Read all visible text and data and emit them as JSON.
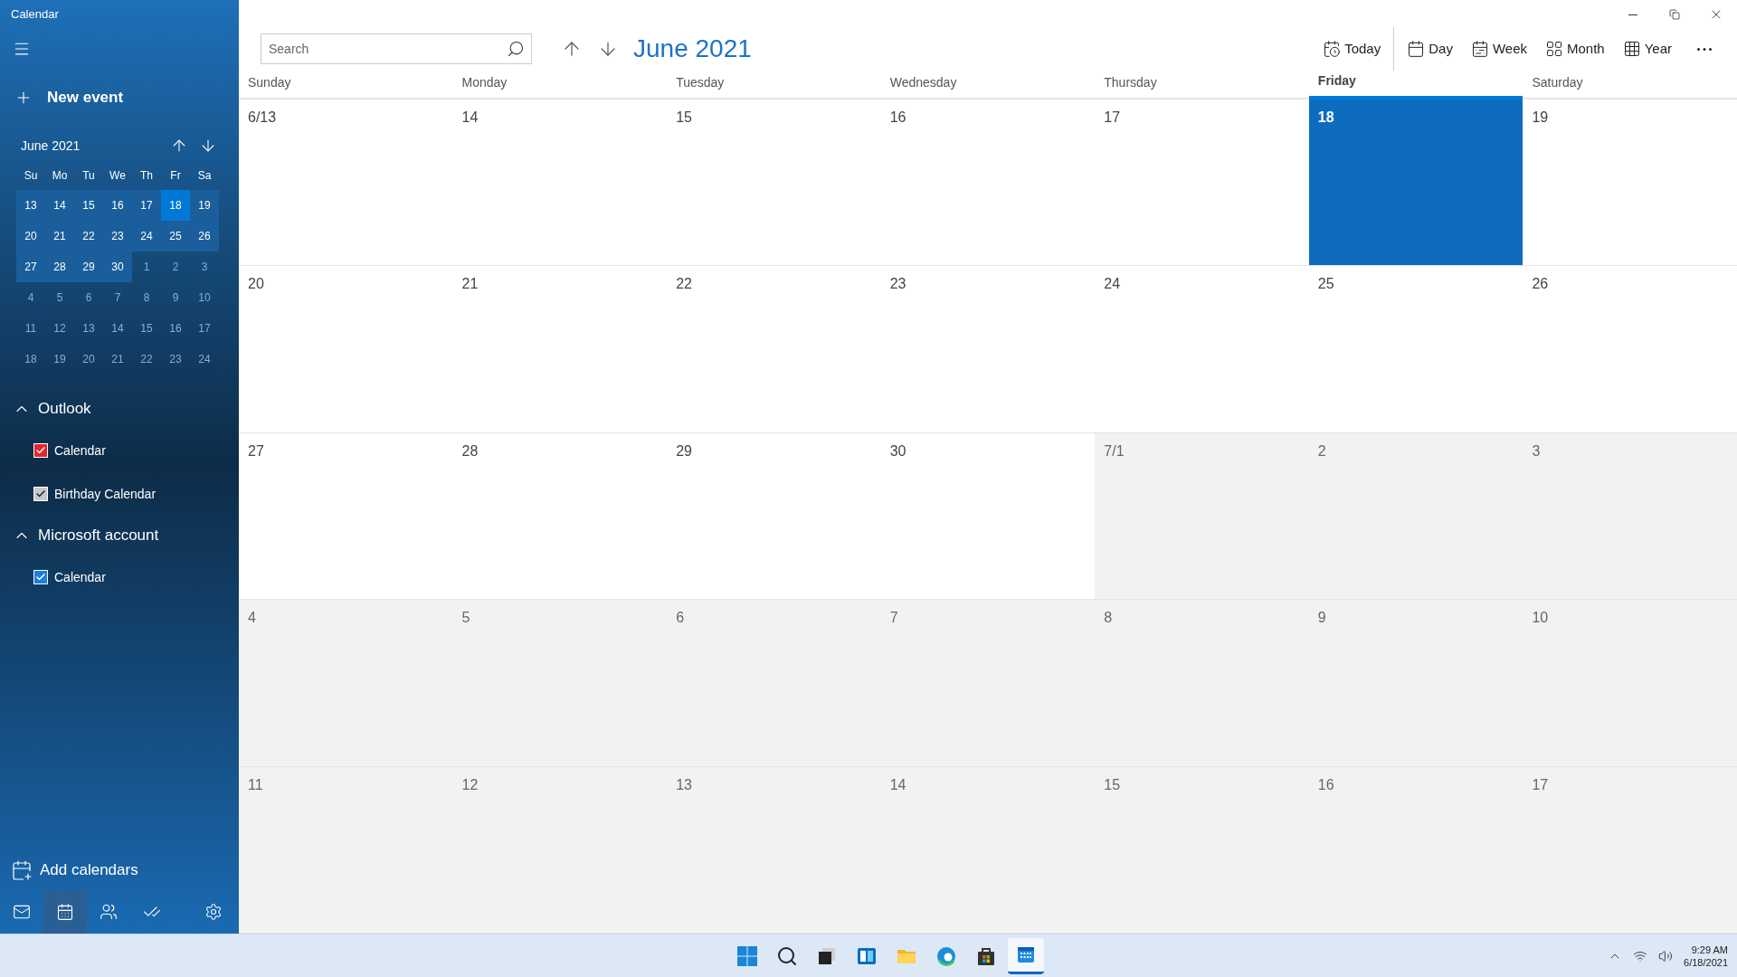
{
  "window": {
    "title": "Calendar"
  },
  "sidebar": {
    "new_event": "New event",
    "mini_calendar": {
      "title": "June 2021",
      "weekdays": [
        "Su",
        "Mo",
        "Tu",
        "We",
        "Th",
        "Fr",
        "Sa"
      ],
      "weeks": [
        [
          {
            "text": "13",
            "in_range": true,
            "selected": false
          },
          {
            "text": "14",
            "in_range": true,
            "selected": false
          },
          {
            "text": "15",
            "in_range": true,
            "selected": false
          },
          {
            "text": "16",
            "in_range": true,
            "selected": false
          },
          {
            "text": "17",
            "in_range": true,
            "selected": false
          },
          {
            "text": "18",
            "in_range": true,
            "selected": true
          },
          {
            "text": "19",
            "in_range": true,
            "selected": false
          }
        ],
        [
          {
            "text": "20",
            "in_range": true,
            "selected": false
          },
          {
            "text": "21",
            "in_range": true,
            "selected": false
          },
          {
            "text": "22",
            "in_range": true,
            "selected": false
          },
          {
            "text": "23",
            "in_range": true,
            "selected": false
          },
          {
            "text": "24",
            "in_range": true,
            "selected": false
          },
          {
            "text": "25",
            "in_range": true,
            "selected": false
          },
          {
            "text": "26",
            "in_range": true,
            "selected": false
          }
        ],
        [
          {
            "text": "27",
            "in_range": true,
            "selected": false
          },
          {
            "text": "28",
            "in_range": true,
            "selected": false
          },
          {
            "text": "29",
            "in_range": true,
            "selected": false
          },
          {
            "text": "30",
            "in_range": true,
            "selected": false
          },
          {
            "text": "1",
            "in_range": false,
            "selected": false
          },
          {
            "text": "2",
            "in_range": false,
            "selected": false
          },
          {
            "text": "3",
            "in_range": false,
            "selected": false
          }
        ],
        [
          {
            "text": "4",
            "in_range": false,
            "selected": false
          },
          {
            "text": "5",
            "in_range": false,
            "selected": false
          },
          {
            "text": "6",
            "in_range": false,
            "selected": false
          },
          {
            "text": "7",
            "in_range": false,
            "selected": false
          },
          {
            "text": "8",
            "in_range": false,
            "selected": false
          },
          {
            "text": "9",
            "in_range": false,
            "selected": false
          },
          {
            "text": "10",
            "in_range": false,
            "selected": false
          }
        ],
        [
          {
            "text": "11",
            "in_range": false,
            "selected": false
          },
          {
            "text": "12",
            "in_range": false,
            "selected": false
          },
          {
            "text": "13",
            "in_range": false,
            "selected": false
          },
          {
            "text": "14",
            "in_range": false,
            "selected": false
          },
          {
            "text": "15",
            "in_range": false,
            "selected": false
          },
          {
            "text": "16",
            "in_range": false,
            "selected": false
          },
          {
            "text": "17",
            "in_range": false,
            "selected": false
          }
        ],
        [
          {
            "text": "18",
            "in_range": false,
            "selected": false
          },
          {
            "text": "19",
            "in_range": false,
            "selected": false
          },
          {
            "text": "20",
            "in_range": false,
            "selected": false
          },
          {
            "text": "21",
            "in_range": false,
            "selected": false
          },
          {
            "text": "22",
            "in_range": false,
            "selected": false
          },
          {
            "text": "23",
            "in_range": false,
            "selected": false
          },
          {
            "text": "24",
            "in_range": false,
            "selected": false
          }
        ]
      ]
    },
    "accounts": [
      {
        "name": "Outlook",
        "expanded": true,
        "calendars": [
          {
            "name": "Calendar",
            "checked": true,
            "color": "#e3262f"
          },
          {
            "name": "Birthday Calendar",
            "checked": true,
            "color": "#c8c8c8"
          }
        ]
      },
      {
        "name": "Microsoft account",
        "expanded": true,
        "calendars": [
          {
            "name": "Calendar",
            "checked": true,
            "color": "#1a7fe0"
          }
        ]
      }
    ],
    "add_calendars": "Add calendars",
    "nav": [
      {
        "kind": "mail",
        "selected": false
      },
      {
        "kind": "calendar",
        "selected": true
      },
      {
        "kind": "people",
        "selected": false
      },
      {
        "kind": "todo",
        "selected": false
      },
      {
        "kind": "settings",
        "selected": false
      }
    ]
  },
  "toolbar": {
    "search": {
      "placeholder": "Search"
    },
    "title": "June 2021",
    "views": [
      {
        "kind": "today",
        "label": "Today"
      },
      {
        "kind": "day",
        "label": "Day"
      },
      {
        "kind": "week",
        "label": "Week"
      },
      {
        "kind": "month",
        "label": "Month"
      },
      {
        "kind": "year",
        "label": "Year"
      }
    ]
  },
  "month": {
    "weekdays": [
      {
        "label": "Sunday",
        "today": false
      },
      {
        "label": "Monday",
        "today": false
      },
      {
        "label": "Tuesday",
        "today": false
      },
      {
        "label": "Wednesday",
        "today": false
      },
      {
        "label": "Thursday",
        "today": false
      },
      {
        "label": "Friday",
        "today": true
      },
      {
        "label": "Saturday",
        "today": false
      }
    ],
    "weeks": [
      [
        {
          "text": "6/13",
          "in_month": true,
          "today": false
        },
        {
          "text": "14",
          "in_month": true,
          "today": false
        },
        {
          "text": "15",
          "in_month": true,
          "today": false
        },
        {
          "text": "16",
          "in_month": true,
          "today": false
        },
        {
          "text": "17",
          "in_month": true,
          "today": false
        },
        {
          "text": "18",
          "in_month": true,
          "today": true
        },
        {
          "text": "19",
          "in_month": true,
          "today": false
        }
      ],
      [
        {
          "text": "20",
          "in_month": true,
          "today": false
        },
        {
          "text": "21",
          "in_month": true,
          "today": false
        },
        {
          "text": "22",
          "in_month": true,
          "today": false
        },
        {
          "text": "23",
          "in_month": true,
          "today": false
        },
        {
          "text": "24",
          "in_month": true,
          "today": false
        },
        {
          "text": "25",
          "in_month": true,
          "today": false
        },
        {
          "text": "26",
          "in_month": true,
          "today": false
        }
      ],
      [
        {
          "text": "27",
          "in_month": true,
          "today": false
        },
        {
          "text": "28",
          "in_month": true,
          "today": false
        },
        {
          "text": "29",
          "in_month": true,
          "today": false
        },
        {
          "text": "30",
          "in_month": true,
          "today": false
        },
        {
          "text": "7/1",
          "in_month": false,
          "today": false
        },
        {
          "text": "2",
          "in_month": false,
          "today": false
        },
        {
          "text": "3",
          "in_month": false,
          "today": false
        }
      ],
      [
        {
          "text": "4",
          "in_month": false,
          "today": false
        },
        {
          "text": "5",
          "in_month": false,
          "today": false
        },
        {
          "text": "6",
          "in_month": false,
          "today": false
        },
        {
          "text": "7",
          "in_month": false,
          "today": false
        },
        {
          "text": "8",
          "in_month": false,
          "today": false
        },
        {
          "text": "9",
          "in_month": false,
          "today": false
        },
        {
          "text": "10",
          "in_month": false,
          "today": false
        }
      ],
      [
        {
          "text": "11",
          "in_month": false,
          "today": false
        },
        {
          "text": "12",
          "in_month": false,
          "today": false
        },
        {
          "text": "13",
          "in_month": false,
          "today": false
        },
        {
          "text": "14",
          "in_month": false,
          "today": false
        },
        {
          "text": "15",
          "in_month": false,
          "today": false
        },
        {
          "text": "16",
          "in_month": false,
          "today": false
        },
        {
          "text": "17",
          "in_month": false,
          "today": false
        }
      ]
    ]
  },
  "taskbar": {
    "apps": [
      {
        "kind": "start",
        "selected": false
      },
      {
        "kind": "search",
        "selected": false
      },
      {
        "kind": "task-view",
        "selected": false
      },
      {
        "kind": "widgets",
        "selected": false
      },
      {
        "kind": "folder",
        "selected": false
      },
      {
        "kind": "browser",
        "selected": false
      },
      {
        "kind": "store",
        "selected": false
      },
      {
        "kind": "calendar",
        "selected": true
      }
    ],
    "time": "9:29 AM",
    "date": "6/18/2021"
  }
}
